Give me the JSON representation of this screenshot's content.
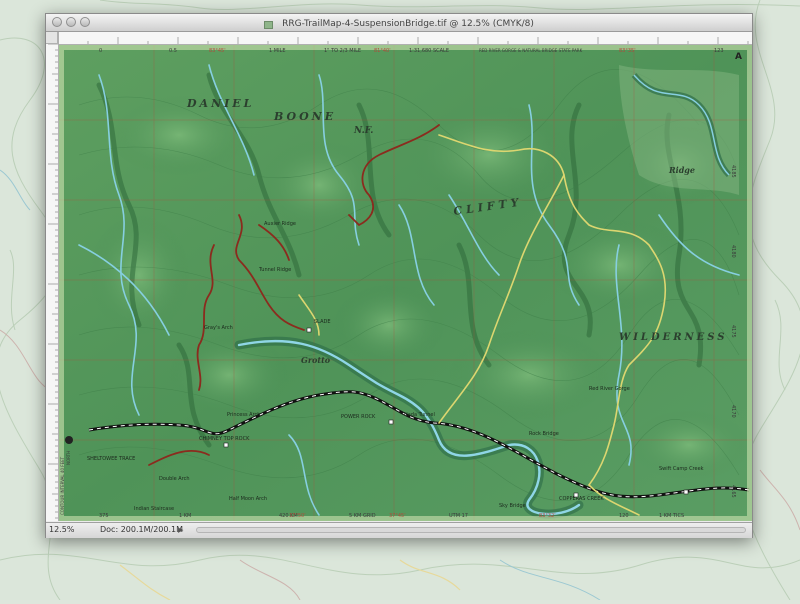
{
  "window": {
    "title": "RRG-TrailMap-4-SuspensionBridge.tif @ 12.5% (CMYK/8)",
    "zoom": "12.5%",
    "doc_info": "Doc: 200.1M/200.1M"
  },
  "map": {
    "wilderness_name": [
      "DANIEL",
      "BOONE",
      "N.F.",
      "CLIFTY",
      "WILDERNESS"
    ],
    "area_labels": [
      "Grotto",
      "Ridge"
    ],
    "place_labels": [
      "SLADE",
      "POWER ROCK",
      "COPPERAS CREEK",
      "Nada Tunnel",
      "Sky Bridge",
      "SHELTOWEE TRACE",
      "CHIMNEY TOP ROCK",
      "Rock Bridge",
      "Princess Arch",
      "Half Moon Arch",
      "Swift Camp Creek",
      "Gray's Arch",
      "Auxier Ridge",
      "Double Arch",
      "Indian Staircase",
      "Tunnel Ridge",
      "Red River Gorge"
    ],
    "header_info": [
      "1 MILE",
      "1\" TO 2/3 MILE",
      "1:31,680 SCALE",
      "RED RIVER GORGE & NATURAL BRIDGE STATE PARK"
    ],
    "footer_info": [
      "1 KM",
      "420 KM",
      "5 KM GRID",
      "UTM 17",
      "1 KM TICS"
    ],
    "grid_numbers": [
      "0",
      "0.5",
      "83°45'",
      "81°40'",
      "37°50'",
      "37°45'",
      "83°32'",
      "83°35'",
      "120",
      "123",
      "375",
      "4185",
      "4180",
      "4175",
      "4170",
      "4165",
      "CONTOUR INTERVAL 40 FEET",
      "NORTH",
      "A"
    ]
  },
  "icons": {
    "document": "document-icon",
    "close": "close-button-icon",
    "minimize": "minimize-button-icon",
    "zoom": "zoom-button-icon"
  },
  "colors": {
    "terrain": "#4e9a5a",
    "water": "#7fc9da",
    "trail_red": "#8b2b1e",
    "trail_yellow": "#d9d46b",
    "road": "#1b1b1b"
  }
}
